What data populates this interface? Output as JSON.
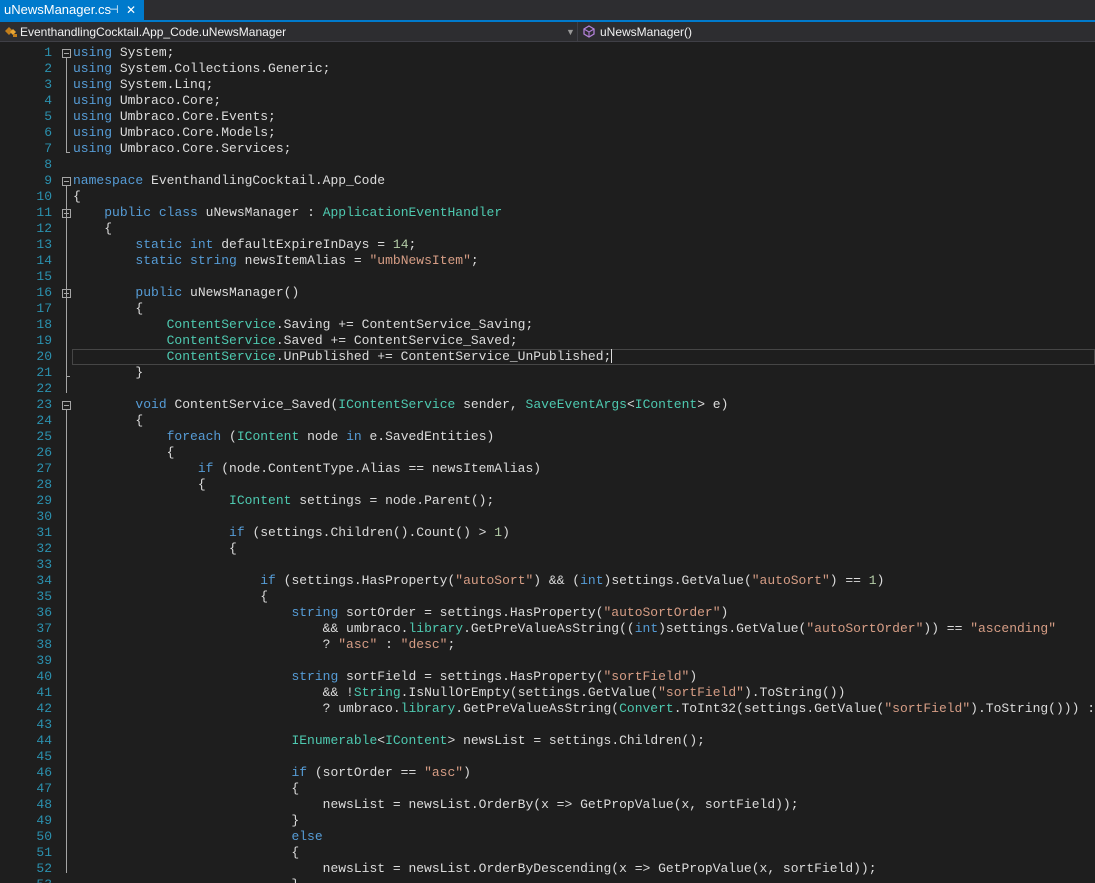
{
  "tab": {
    "title": "uNewsManager.cs",
    "pin_glyph": "⊣",
    "close_glyph": "✕"
  },
  "nav": {
    "type_dropdown": "EventhandlingCocktail.App_Code.uNewsManager",
    "member_dropdown": "uNewsManager()"
  },
  "colors": {
    "accent": "#007acc",
    "keyword": "#569cd6",
    "type": "#4ec9b0",
    "string": "#d69d85",
    "number": "#b5cea8",
    "line_number": "#2b91af"
  },
  "code_lines": [
    "{k:using} System;",
    "{k:using} System.Collections.Generic;",
    "{k:using} System.Linq;",
    "{k:using} Umbraco.Core;",
    "{k:using} Umbraco.Core.Events;",
    "{k:using} Umbraco.Core.Models;",
    "{k:using} Umbraco.Core.Services;",
    "",
    "{k:namespace} EventhandlingCocktail.App_Code",
    "{",
    "    {k:public} {k:class} uNewsManager : {t:ApplicationEventHandler}",
    "    {",
    "        {k:static} {k:int} defaultExpireInDays = {n:14};",
    "        {k:static} {k:string} newsItemAlias = {s:\"umbNewsItem\"};",
    "",
    "        {k:public} uNewsManager()",
    "        {",
    "            {t:ContentService}.Saving += ContentService_Saving;",
    "            {t:ContentService}.Saved += ContentService_Saved;",
    "            {t:ContentService}.UnPublished += ContentService_UnPublished;",
    "        }",
    "",
    "        {k:void} ContentService_Saved({t:IContentService} sender, {t:SaveEventArgs}<{t:IContent}> e)",
    "        {",
    "            {k:foreach} ({t:IContent} node {k:in} e.SavedEntities)",
    "            {",
    "                {k:if} (node.ContentType.Alias == newsItemAlias)",
    "                {",
    "                    {t:IContent} settings = node.Parent();",
    "",
    "                    {k:if} (settings.Children().Count() > {n:1})",
    "                    {",
    "",
    "                        {k:if} (settings.HasProperty({s:\"autoSort\"}) && ({k:int})settings.GetValue({s:\"autoSort\"}) == {n:1})",
    "                        {",
    "                            {k:string} sortOrder = settings.HasProperty({s:\"autoSortOrder\"})",
    "                                && umbraco.{t:library}.GetPreValueAsString(({k:int})settings.GetValue({s:\"autoSortOrder\"})) == {s:\"ascending\"}",
    "                                ? {s:\"asc\"} : {s:\"desc\"};",
    "",
    "                            {k:string} sortField = settings.HasProperty({s:\"sortField\"})",
    "                                && !{t:String}.IsNullOrEmpty(settings.GetValue({s:\"sortField\"}).ToString())",
    "                                ? umbraco.{t:library}.GetPreValueAsString({t:Convert}.ToInt32(settings.GetValue({s:\"sortField\"}).ToString())) : {s:\"CreateDate\"};",
    "",
    "                            {t:IEnumerable}<{t:IContent}> newsList = settings.Children();",
    "",
    "                            {k:if} (sortOrder == {s:\"asc\"})",
    "                            {",
    "                                newsList = newsList.OrderBy(x => GetPropValue(x, sortField));",
    "                            }",
    "                            {k:else}",
    "                            {",
    "                                newsList = newsList.OrderByDescending(x => GetPropValue(x, sortField));",
    "                            }"
  ]
}
